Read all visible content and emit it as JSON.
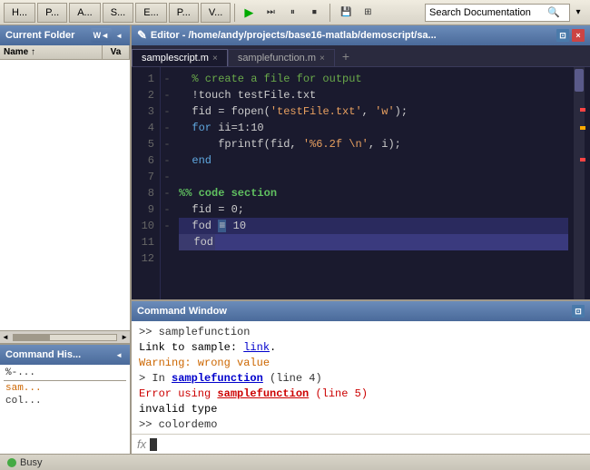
{
  "toolbar": {
    "tabs": [
      {
        "label": "H...",
        "id": "home"
      },
      {
        "label": "P...",
        "id": "plots"
      },
      {
        "label": "A...",
        "id": "apps"
      },
      {
        "label": "S...",
        "id": "scripts"
      },
      {
        "label": "E...",
        "id": "editor"
      },
      {
        "label": "P...",
        "id": "publish"
      },
      {
        "label": "V...",
        "id": "view"
      }
    ],
    "search_placeholder": "Search Documentation",
    "search_value": "Search Documentation"
  },
  "left_panel": {
    "folder_title": "Current Folder",
    "folder_tab_short": "W◄",
    "col_name": "Name",
    "col_sort": "↑",
    "col_val": "Va",
    "history_title": "Command His...",
    "history_items": [
      {
        "text": "%-...",
        "type": "normal"
      },
      {
        "text": "sam...",
        "type": "orange"
      },
      {
        "text": "col...",
        "type": "normal"
      }
    ]
  },
  "editor": {
    "title": "Editor - /home/andy/projects/base16-matlab/demoscript/sa...",
    "tabs": [
      {
        "label": "samplescript.m",
        "active": true
      },
      {
        "label": "samplefunction.m",
        "active": false
      }
    ],
    "code_lines": [
      {
        "num": 1,
        "content": "  % create a file for output",
        "type": "comment"
      },
      {
        "num": 2,
        "content": "  !touch testFile.txt",
        "type": "normal"
      },
      {
        "num": 3,
        "content": "  fid = fopen('testFile.txt', 'w');",
        "type": "mixed"
      },
      {
        "num": 4,
        "content": "  for ii=1:10",
        "type": "for"
      },
      {
        "num": 5,
        "content": "      fprintf(fid, '%6.2f \\n', i);",
        "type": "mixed"
      },
      {
        "num": 6,
        "content": "  end",
        "type": "keyword"
      },
      {
        "num": 7,
        "content": "",
        "type": "empty"
      },
      {
        "num": 8,
        "content": "%% code section",
        "type": "section"
      },
      {
        "num": 9,
        "content": "  fid = 0;",
        "type": "normal"
      },
      {
        "num": 10,
        "content": "  fod = 10",
        "type": "highlight"
      },
      {
        "num": 11,
        "content": "  fod",
        "type": "selected"
      },
      {
        "num": 12,
        "content": "",
        "type": "empty"
      }
    ]
  },
  "command_window": {
    "title": "Command Window",
    "lines": [
      {
        "type": "prompt",
        "text": ">>  samplefunction"
      },
      {
        "type": "link-line",
        "prefix": "Link to sample: ",
        "link": "link",
        "suffix": "."
      },
      {
        "type": "warning",
        "text": "Warning: wrong value"
      },
      {
        "type": "error-loc",
        "prefix": "> In ",
        "func": "samplefunction",
        "suffix": " (line 4)"
      },
      {
        "type": "error-msg",
        "prefix": "Error using ",
        "func": "samplefunction",
        "suffix": " (line 5)"
      },
      {
        "type": "error-text",
        "text": "invalid type"
      },
      {
        "type": "prompt",
        "text": ">>  colordemo"
      }
    ],
    "input_placeholder": ""
  },
  "status_bar": {
    "status": "Busy"
  },
  "icons": {
    "play": "▶",
    "search": "🔍",
    "filter": "▾",
    "close": "×",
    "expand": "⊡",
    "arrow_up": "▲",
    "arrow_down": "▼",
    "arrow_left": "◄",
    "arrow_right": "►",
    "arrow_right_small": "►",
    "plus": "+",
    "minus": "–"
  }
}
